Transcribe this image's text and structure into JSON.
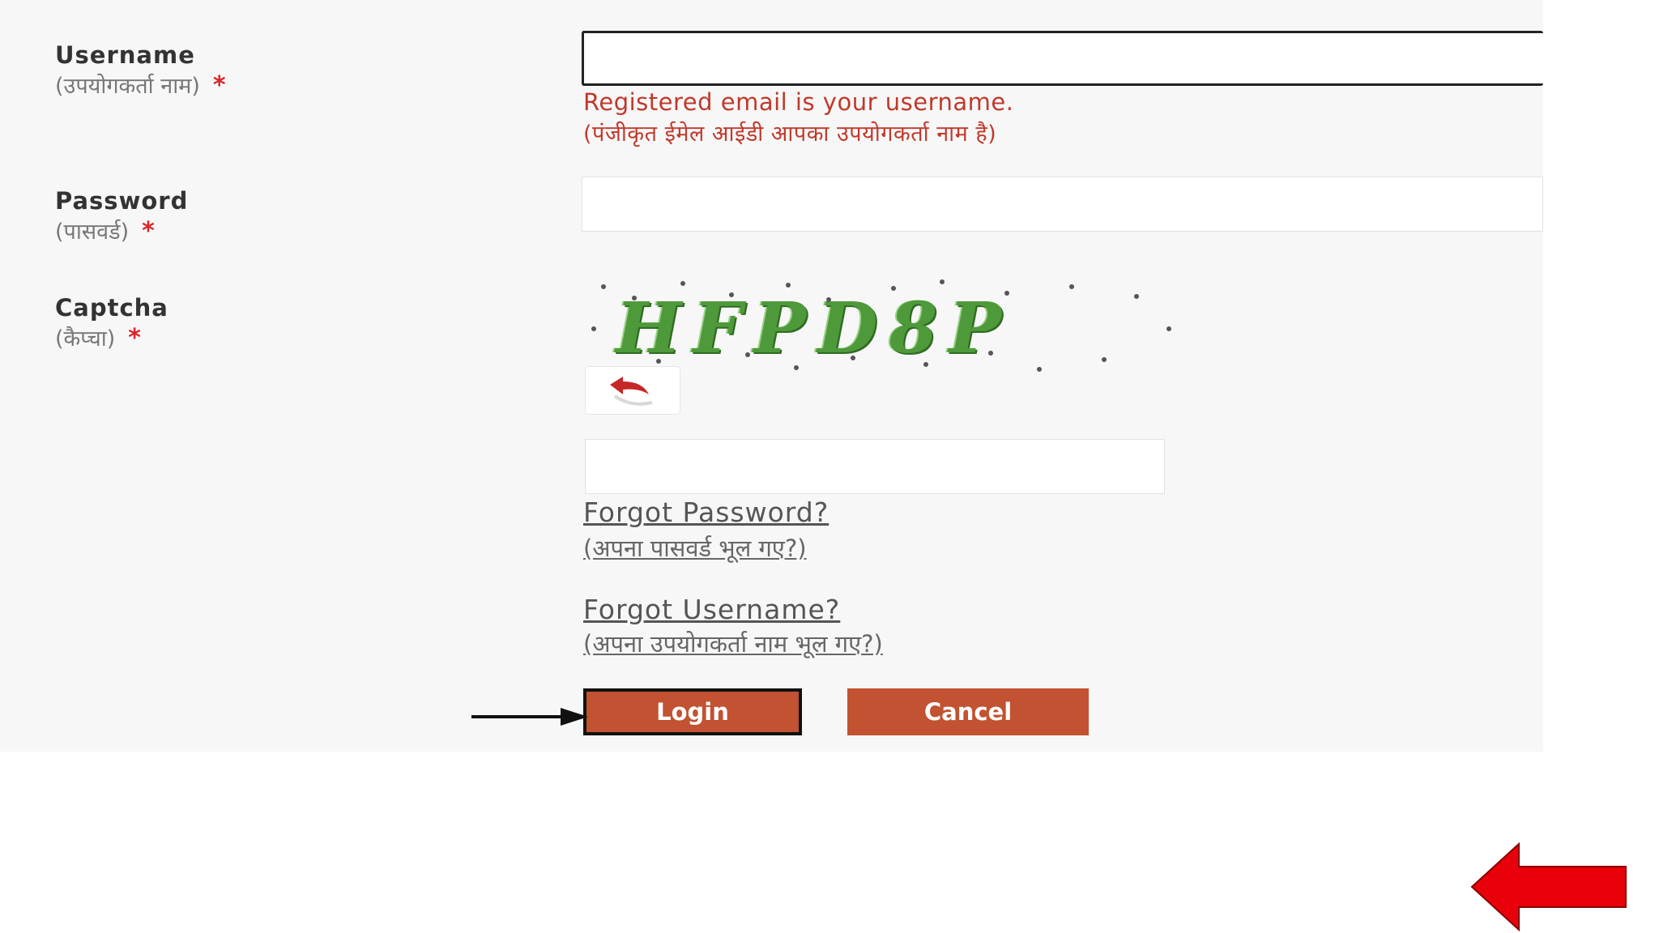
{
  "form": {
    "username": {
      "label": "Username",
      "label_hi": "(उपयोगकर्ता नाम)",
      "required_mark": "*",
      "value": "",
      "hint": "Registered email is your username.",
      "hint_hi": "(पंजीकृत ईमेल आईडी आपका उपयोगकर्ता नाम है)"
    },
    "password": {
      "label": "Password",
      "label_hi": "(पासवर्ड)",
      "required_mark": "*",
      "value": ""
    },
    "captcha": {
      "label": "Captcha",
      "label_hi": "(कैप्चा)",
      "required_mark": "*",
      "image_text": "HFPD8P",
      "value": ""
    },
    "forgot_password": {
      "text": "Forgot Password?",
      "text_hi": "(अपना पासवर्ड भूल गए?)"
    },
    "forgot_username": {
      "text": "Forgot Username?",
      "text_hi": "(अपना उपयोगकर्ता नाम भूल गए?)"
    },
    "buttons": {
      "login": "Login",
      "cancel": "Cancel"
    }
  },
  "colors": {
    "button_bg": "#c25231",
    "hint_text": "#c0392b",
    "required": "#d9252a",
    "captcha_green": "#4e9a3a",
    "annotation_red_arrow": "#e8000b"
  },
  "icons": {
    "refresh": "refresh-arrow-icon",
    "annotation_black": "arrow-right-icon",
    "annotation_red": "arrow-left-icon"
  }
}
